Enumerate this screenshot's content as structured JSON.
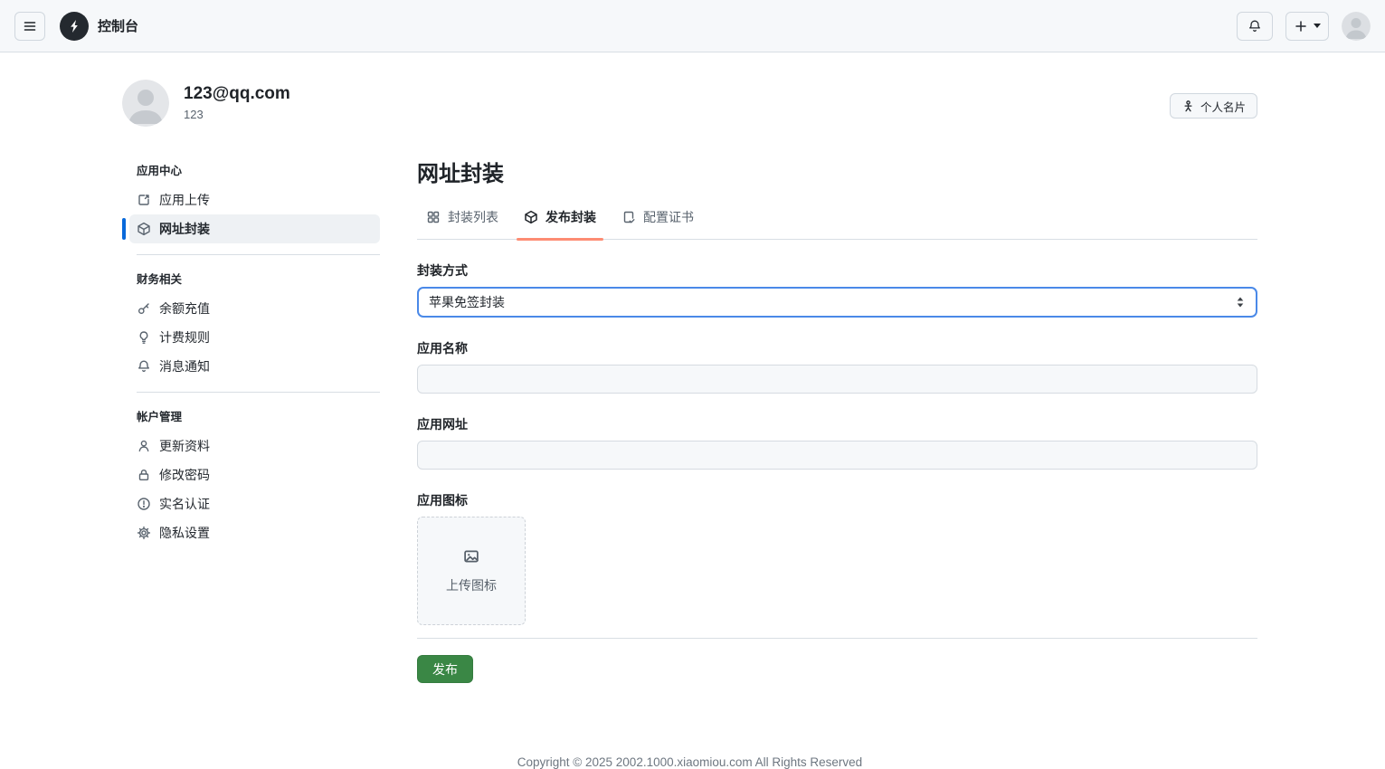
{
  "header": {
    "title": "控制台",
    "icons": [
      "hamburger-icon",
      "lightning-logo",
      "bell-icon",
      "plus-icon",
      "caret-down-icon",
      "avatar"
    ]
  },
  "profile": {
    "email": "123@qq.com",
    "name": "123",
    "card_button": "个人名片"
  },
  "sidebar": {
    "sections": [
      {
        "title": "应用中心",
        "items": [
          {
            "label": "应用上传",
            "icon": "upload-icon",
            "active": false
          },
          {
            "label": "网址封装",
            "icon": "cube-icon",
            "active": true
          }
        ]
      },
      {
        "title": "财务相关",
        "items": [
          {
            "label": "余额充值",
            "icon": "key-icon",
            "active": false
          },
          {
            "label": "计费规则",
            "icon": "lightbulb-icon",
            "active": false
          },
          {
            "label": "消息通知",
            "icon": "bell-icon",
            "active": false
          }
        ]
      },
      {
        "title": "帐户管理",
        "items": [
          {
            "label": "更新资料",
            "icon": "person-icon",
            "active": false
          },
          {
            "label": "修改密码",
            "icon": "lock-icon",
            "active": false
          },
          {
            "label": "实名认证",
            "icon": "shield-check-icon",
            "active": false
          },
          {
            "label": "隐私设置",
            "icon": "gear-icon",
            "active": false
          }
        ]
      }
    ]
  },
  "main": {
    "title": "网址封装",
    "tabs": [
      {
        "label": "封装列表",
        "icon": "grid-icon",
        "active": false
      },
      {
        "label": "发布封装",
        "icon": "cube-icon",
        "active": true
      },
      {
        "label": "配置证书",
        "icon": "file-check-icon",
        "active": false
      }
    ],
    "form": {
      "method_label": "封装方式",
      "method_value": "苹果免签封装",
      "name_label": "应用名称",
      "name_value": "",
      "url_label": "应用网址",
      "url_value": "",
      "icon_label": "应用图标",
      "upload_text": "上传图标",
      "submit_label": "发布"
    }
  },
  "footer": {
    "copyright": "Copyright © 2025 2002.1000.xiaomiou.com All Rights Reserved"
  },
  "colors": {
    "accent_blue": "#0969da",
    "select_border_blue": "#4a89e8",
    "tab_underline": "#fd8c73",
    "publish_green": "#3a8745",
    "header_bg": "#f6f8fa",
    "border": "#d0d7de"
  }
}
